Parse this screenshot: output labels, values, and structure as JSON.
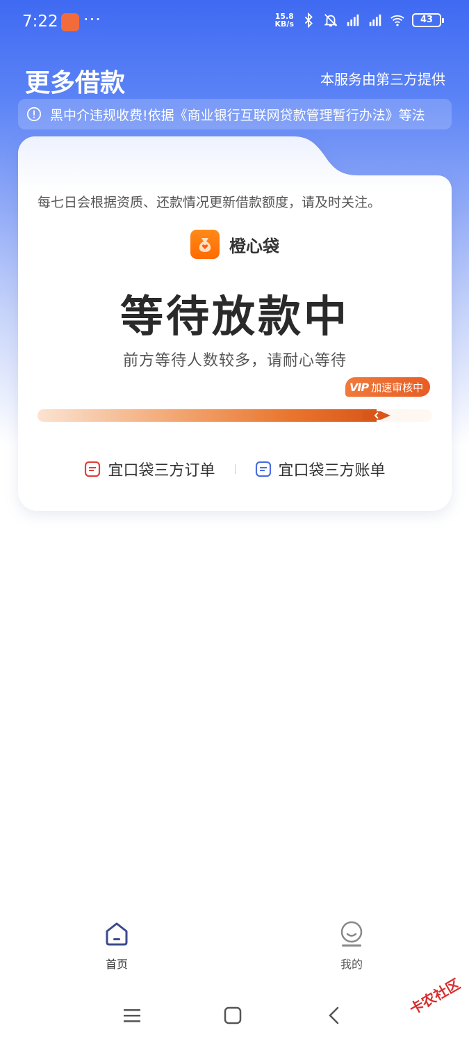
{
  "status_bar": {
    "time": "7:22",
    "more": "···",
    "net_speed_value": "15.8",
    "net_speed_unit": "KB/s",
    "battery": "43",
    "icons": [
      "bluetooth-icon",
      "mute-icon",
      "signal-hd-icon",
      "signal-hd-icon",
      "wifi-icon",
      "battery-icon"
    ]
  },
  "header": {
    "title": "更多借款",
    "provider": "本服务由第三方提供"
  },
  "notice": {
    "icon": "info-icon",
    "text": "黑中介违规收费!依据《商业银行互联网贷款管理暂行办法》等法"
  },
  "card": {
    "note": "每七日会根据资质、还款情况更新借款额度，请及时关注。",
    "brand_name": "橙心袋",
    "status_title": "等待放款中",
    "status_subtitle": "前方等待人数较多，请耐心等待",
    "vip_mark": "VIP",
    "vip_label": "加速审核中",
    "progress": 0.86,
    "links": [
      {
        "label": "宜口袋三方订单",
        "icon": "order-icon",
        "color": "#e0403a"
      },
      {
        "label": "宜口袋三方账单",
        "icon": "bill-icon",
        "color": "#4a6ee0"
      }
    ]
  },
  "bottom_nav": [
    {
      "label": "首页",
      "icon": "home-icon",
      "active": true
    },
    {
      "label": "我的",
      "icon": "profile-icon",
      "active": false
    }
  ],
  "system_nav": [
    "menu-icon",
    "home-square-icon",
    "back-icon"
  ],
  "watermark": "卡农社区",
  "colors": {
    "accent": "#3f6af2",
    "orange": "#e8752e",
    "nav_active": "#3b4a8c",
    "nav_inactive": "#888888"
  }
}
